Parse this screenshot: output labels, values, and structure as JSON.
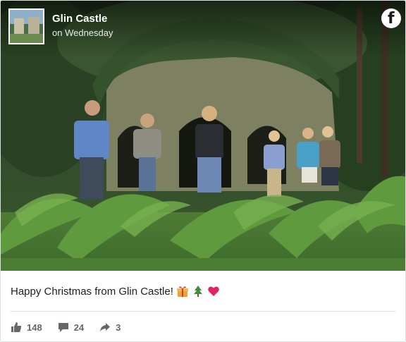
{
  "post": {
    "page_name": "Glin Castle",
    "time": "on Wednesday",
    "caption": "Happy Christmas from Glin Castle!",
    "caption_emojis": [
      "gift-icon",
      "christmas-tree-icon",
      "heart-icon"
    ]
  },
  "stats": {
    "likes": "148",
    "comments": "24",
    "shares": "3"
  },
  "icons": {
    "brand": "facebook-logo-icon",
    "like": "thumbs-up-icon",
    "comment": "comment-icon",
    "share": "share-arrow-icon"
  },
  "colors": {
    "heart": "#e0245e",
    "stat_text": "#65676b",
    "caption_text": "#1c1e21"
  }
}
